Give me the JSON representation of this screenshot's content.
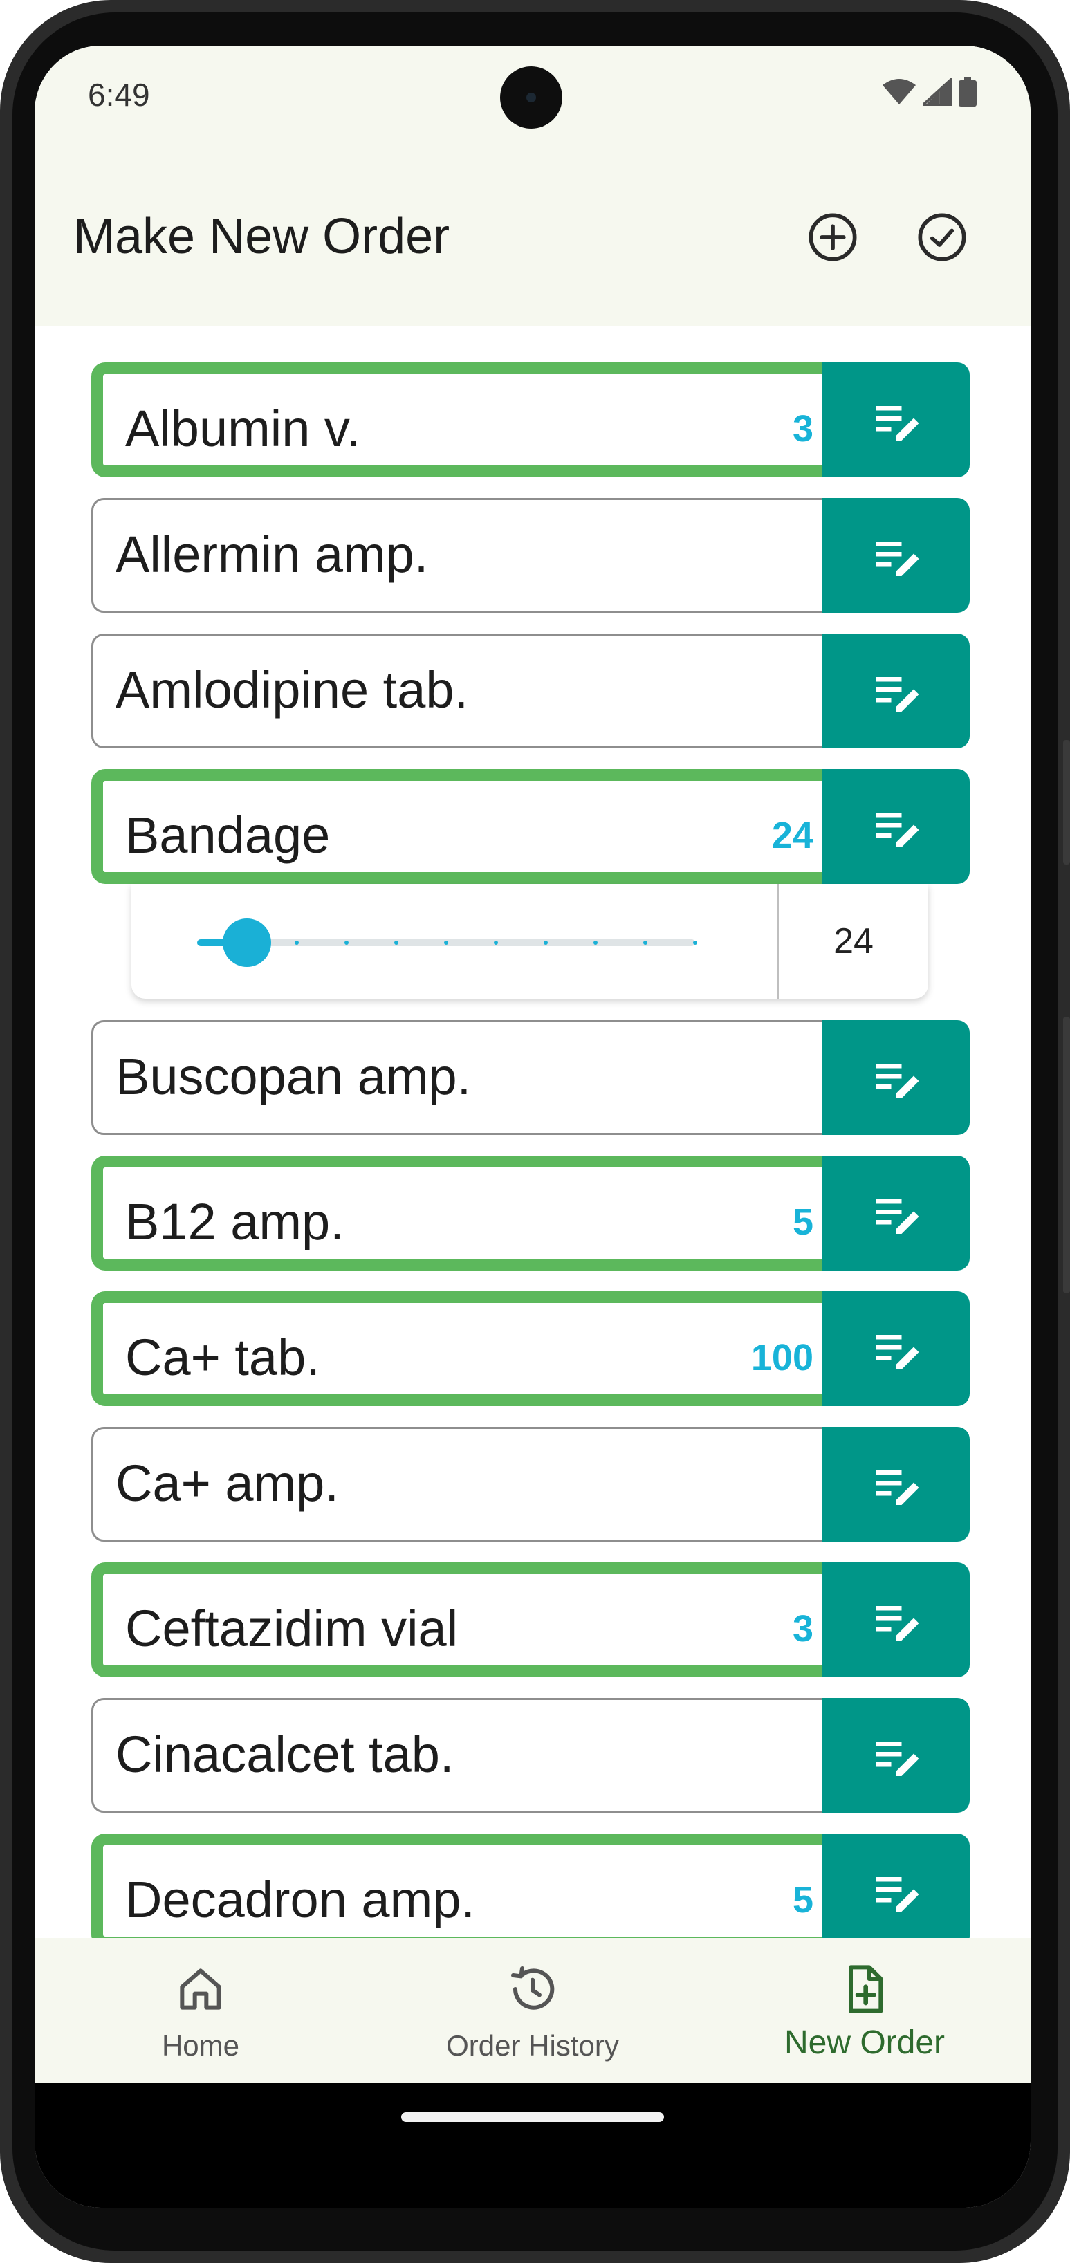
{
  "status_bar": {
    "time": "6:49"
  },
  "app_bar": {
    "title": "Make New Order"
  },
  "items": [
    {
      "name": "Albumin v.",
      "qty": "3",
      "selected": true
    },
    {
      "name": "Allermin amp.",
      "qty": "",
      "selected": false
    },
    {
      "name": "Amlodipine tab.",
      "qty": "",
      "selected": false
    },
    {
      "name": "Bandage",
      "qty": "24",
      "selected": true
    },
    {
      "name": "Buscopan amp.",
      "qty": "",
      "selected": false
    },
    {
      "name": "B12 amp.",
      "qty": "5",
      "selected": true
    },
    {
      "name": "Ca+ tab.",
      "qty": "100",
      "selected": true
    },
    {
      "name": "Ca+ amp.",
      "qty": "",
      "selected": false
    },
    {
      "name": "Ceftazidim vial",
      "qty": "3",
      "selected": true
    },
    {
      "name": "Cinacalcet tab.",
      "qty": "",
      "selected": false
    },
    {
      "name": "Decadron amp.",
      "qty": "5",
      "selected": true
    }
  ],
  "expanded": {
    "value": "24",
    "slider_fraction": 0.1
  },
  "bottom_nav": {
    "home": "Home",
    "history": "Order History",
    "new_order": "New Order"
  },
  "colors": {
    "accent_teal": "#009688",
    "selected_green": "#5cb85c",
    "qty_blue": "#18b3d8",
    "bar_background": "#f6f8ef"
  }
}
